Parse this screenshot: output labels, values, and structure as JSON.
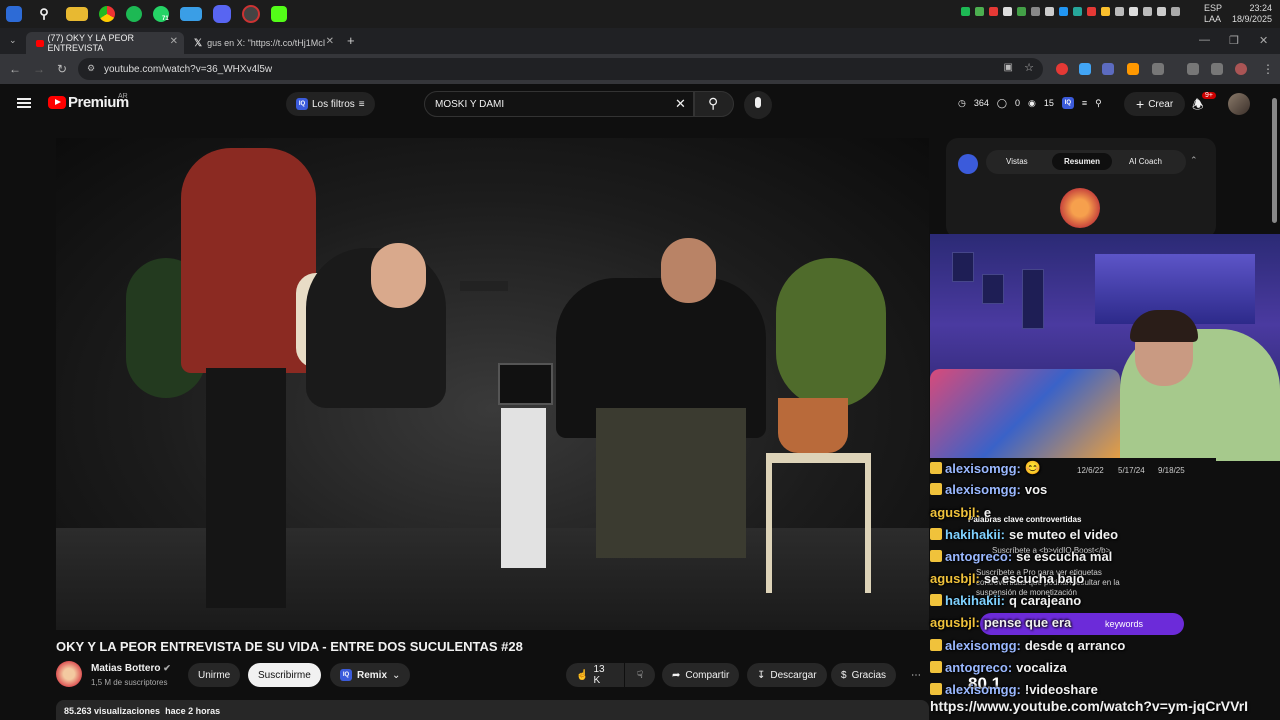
{
  "taskbar": {
    "icons": [
      "windows-icon",
      "search-icon",
      "explorer-icon",
      "chrome-icon",
      "spotify-icon",
      "whatsapp-icon",
      "photos-icon",
      "discord-icon",
      "browser-icon",
      "kick-icon"
    ],
    "whatsapp_badge": "71",
    "lang_line1": "ESP",
    "lang_line2": "LAA",
    "time": "23:24",
    "date": "18/9/2025"
  },
  "browser": {
    "tabs": [
      {
        "label": "(77) OKY Y LA PEOR ENTREVISTA",
        "active": true
      },
      {
        "label": "gus en X: \"https://t.co/tHj1McI",
        "active": false
      }
    ],
    "new_tab": "+",
    "url": "youtube.com/watch?v=36_WHXv4l5w"
  },
  "yt": {
    "logo_text": "Premium",
    "country": "AR",
    "filters_label": "Los filtros",
    "search_value": "MOSKI Y DAMI",
    "stats": {
      "a": "364",
      "b": "0",
      "c": "15"
    },
    "create_label": "Crear",
    "notif_badge": "9+"
  },
  "video": {
    "title": "OKY Y LA PEOR ENTREVISTA DE SU VIDA - ENTRE DOS SUCULENTAS #28",
    "channel": "Matias Bottero",
    "subs": "1,5 M de suscriptores",
    "join": "Unirme",
    "subscribe": "Suscribirme",
    "remix": "Remix",
    "likes": "13 K",
    "share": "Compartir",
    "download": "Descargar",
    "thanks": "Gracias",
    "more": "⋯",
    "views": "85.263 visualizaciones",
    "ago": "hace 2 horas"
  },
  "panel": {
    "tabs": [
      "Vistas",
      "Resumen",
      "AI Coach"
    ],
    "active_tab": "Resumen"
  },
  "underlay": {
    "dates": [
      "12/6/22",
      "5/17/24",
      "9/18/25"
    ],
    "section_title": "Palabras clave controvertidas",
    "line1": "Suscríbete a <b>vidIQ Boost</b>",
    "line2": "Suscríbete a Pro para ver etiquetas",
    "line3": "controvertidas que podrían resultar en la",
    "line4": "suspensión de monetización",
    "keywords": "keywords",
    "score": "80.1"
  },
  "chat": [
    {
      "user": "alexisomgg:",
      "msg": "😊",
      "color": "#9ab8ff"
    },
    {
      "user": "alexisomgg:",
      "msg": "vos",
      "color": "#9ab8ff"
    },
    {
      "user": "agusbjl:",
      "msg": "e",
      "color": "#f0c23b"
    },
    {
      "user": "hakihakii:",
      "msg": "se muteo el video",
      "color": "#7fd1ff"
    },
    {
      "user": "antogreco:",
      "msg": "se escucha mal",
      "color": "#9ab8ff"
    },
    {
      "user": "agusbjl:",
      "msg": "se escucha bajo",
      "color": "#f0c23b"
    },
    {
      "user": "hakihakii:",
      "msg": "q carajeano",
      "color": "#7fd1ff"
    },
    {
      "user": "agusbjl:",
      "msg": "pense que era",
      "color": "#f0c23b"
    },
    {
      "user": "alexisomgg:",
      "msg": "desde q arranco",
      "color": "#9ab8ff"
    },
    {
      "user": "antogreco:",
      "msg": "vocaliza",
      "color": "#9ab8ff"
    },
    {
      "user": "alexisomgg:",
      "msg": "!videoshare",
      "color": "#9ab8ff"
    }
  ],
  "chat_url": "https://www.youtube.com/watch?v=ym-jqCrVVrI"
}
